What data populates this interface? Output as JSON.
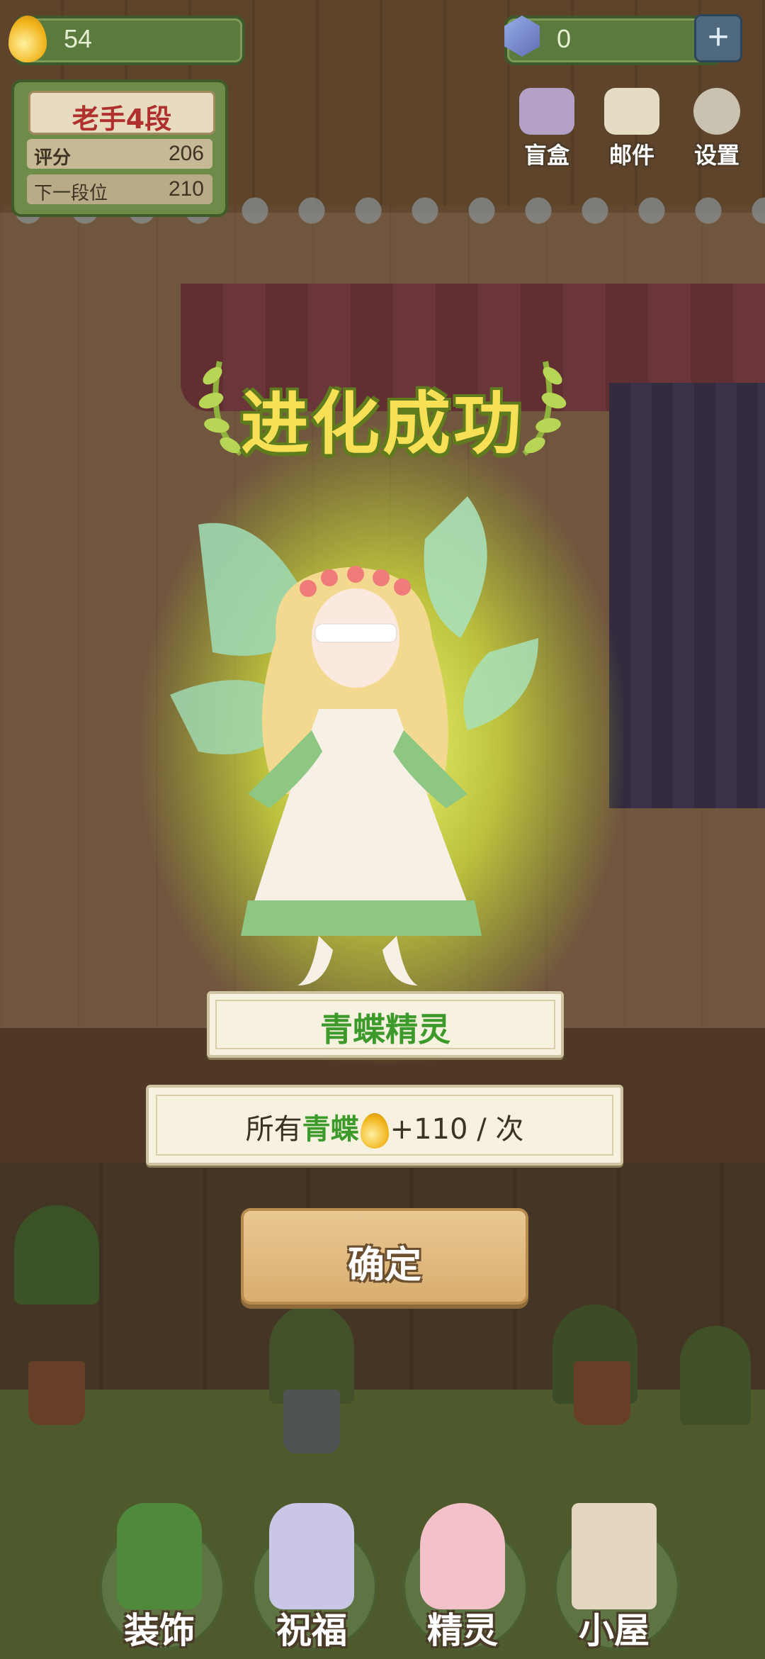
{
  "hud": {
    "drops_value": "54",
    "gems_value": "0",
    "rank": {
      "title": "老手4段",
      "score_label": "评分",
      "score_value": "206",
      "next_label": "下一段位",
      "next_value": "210"
    },
    "top_menu": [
      {
        "label": "盲盒",
        "icon": "gift-box-icon"
      },
      {
        "label": "邮件",
        "icon": "mail-icon"
      },
      {
        "label": "设置",
        "icon": "gear-icon"
      }
    ]
  },
  "dialog": {
    "title": "进化成功",
    "character_name": "青蝶精灵",
    "reward": {
      "prefix": "所有",
      "target": "青蝶",
      "amount": "+110",
      "suffix": "/ 次"
    },
    "confirm_label": "确定"
  },
  "bottom_nav": [
    {
      "label": "装饰",
      "icon": "plant-pot-icon"
    },
    {
      "label": "祝福",
      "icon": "butterfly-vase-icon"
    },
    {
      "label": "精灵",
      "icon": "fairy-icon"
    },
    {
      "label": "小屋",
      "icon": "house-icon"
    }
  ],
  "colors": {
    "accent_green": "#3c9a2a",
    "title_yellow": "#f7df56",
    "rank_red": "#b0302e"
  }
}
